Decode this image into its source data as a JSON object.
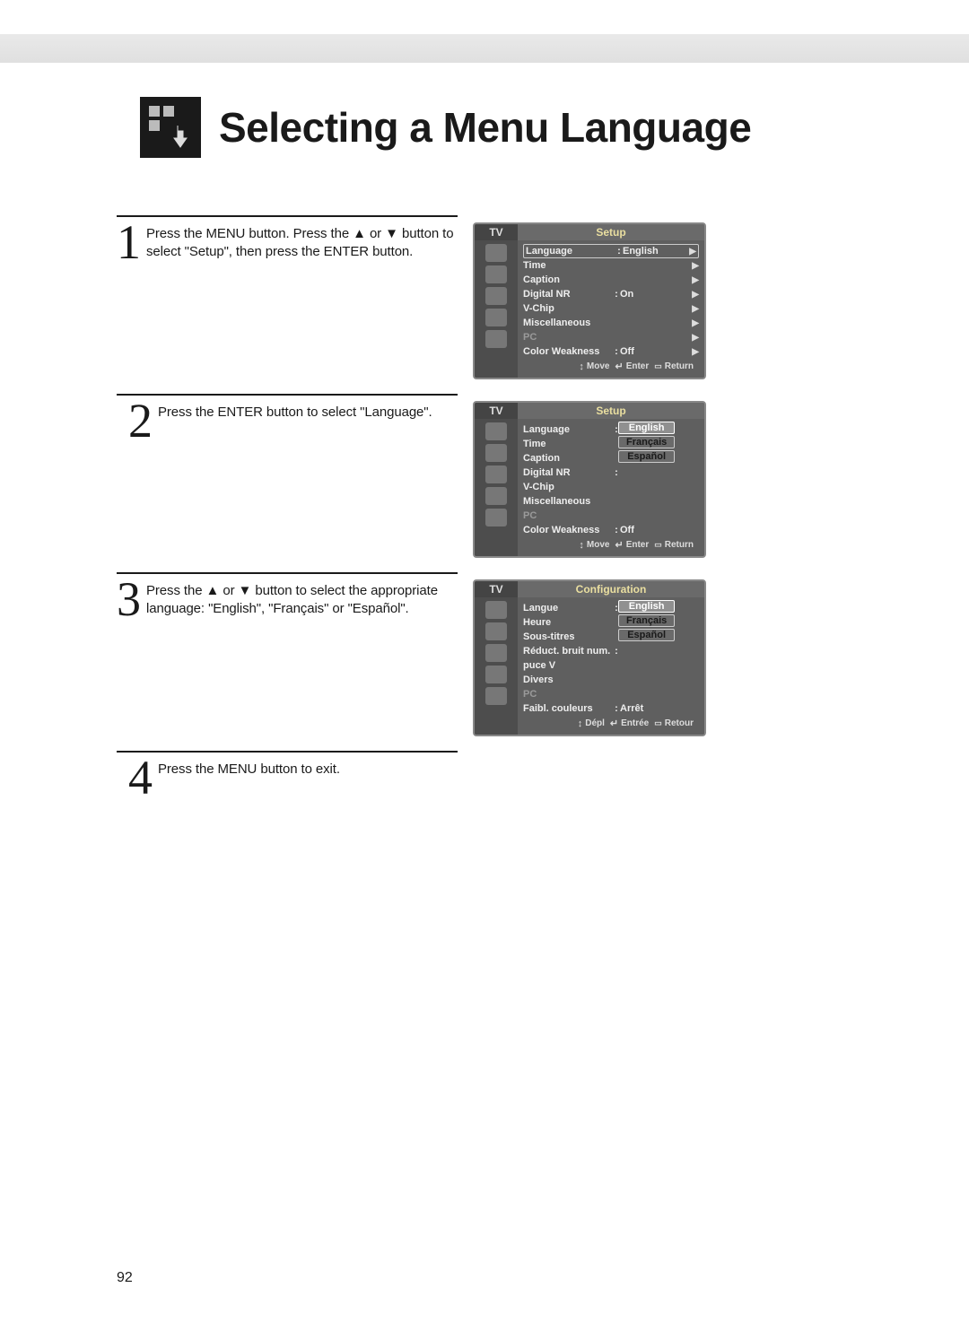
{
  "page_title": "Selecting a Menu Language",
  "page_number": "92",
  "steps": {
    "s1": {
      "num": "1",
      "text": "Press the MENU button. Press the ▲ or ▼ button to select \"Setup\", then press the ENTER button."
    },
    "s2": {
      "num": "2",
      "text": "Press the ENTER button to select \"Language\"."
    },
    "s3": {
      "num": "3",
      "text": "Press the ▲ or ▼ button to select the appropriate language: \"English\", \"Français\" or \"Español\"."
    },
    "s4": {
      "num": "4",
      "text": "Press the MENU button to exit."
    }
  },
  "screens": {
    "sc1": {
      "tv": "TV",
      "title": "Setup",
      "items": [
        {
          "label": "Language",
          "val": "English",
          "selected": true,
          "arrow": true
        },
        {
          "label": "Time",
          "val": "",
          "arrow": true
        },
        {
          "label": "Caption",
          "val": "",
          "arrow": true
        },
        {
          "label": "Digital NR",
          "val": "On",
          "arrow": true
        },
        {
          "label": "V-Chip",
          "val": "",
          "arrow": true
        },
        {
          "label": "Miscellaneous",
          "val": "",
          "arrow": true
        },
        {
          "label": "PC",
          "val": "",
          "arrow": true,
          "dim": true
        },
        {
          "label": "Color Weakness",
          "val": "Off",
          "arrow": true
        }
      ],
      "foot": {
        "move": "Move",
        "enter": "Enter",
        "ret": "Return"
      }
    },
    "sc2": {
      "tv": "TV",
      "title": "Setup",
      "items": [
        {
          "label": "Language",
          "val": ""
        },
        {
          "label": "Time",
          "val": ""
        },
        {
          "label": "Caption",
          "val": ""
        },
        {
          "label": "Digital NR",
          "val": ""
        },
        {
          "label": "V-Chip",
          "val": ""
        },
        {
          "label": "Miscellaneous",
          "val": ""
        },
        {
          "label": "PC",
          "val": "",
          "dim": true
        },
        {
          "label": "Color Weakness",
          "val": "Off"
        }
      ],
      "options": [
        "English",
        "Français",
        "Español"
      ],
      "opt_selected": 0,
      "foot": {
        "move": "Move",
        "enter": "Enter",
        "ret": "Return"
      }
    },
    "sc3": {
      "tv": "TV",
      "title": "Configuration",
      "items": [
        {
          "label": "Langue",
          "val": ""
        },
        {
          "label": "Heure",
          "val": ""
        },
        {
          "label": "Sous-titres",
          "val": ""
        },
        {
          "label": "Réduct. bruit num.",
          "val": ""
        },
        {
          "label": "puce V",
          "val": ""
        },
        {
          "label": "Divers",
          "val": ""
        },
        {
          "label": "PC",
          "val": "",
          "dim": true
        },
        {
          "label": "Faibl. couleurs",
          "val": "Arrêt"
        }
      ],
      "options": [
        "English",
        "Français",
        "Español"
      ],
      "opt_selected": 0,
      "foot": {
        "move": "Dépl",
        "enter": "Entrée",
        "ret": "Retour"
      }
    }
  }
}
